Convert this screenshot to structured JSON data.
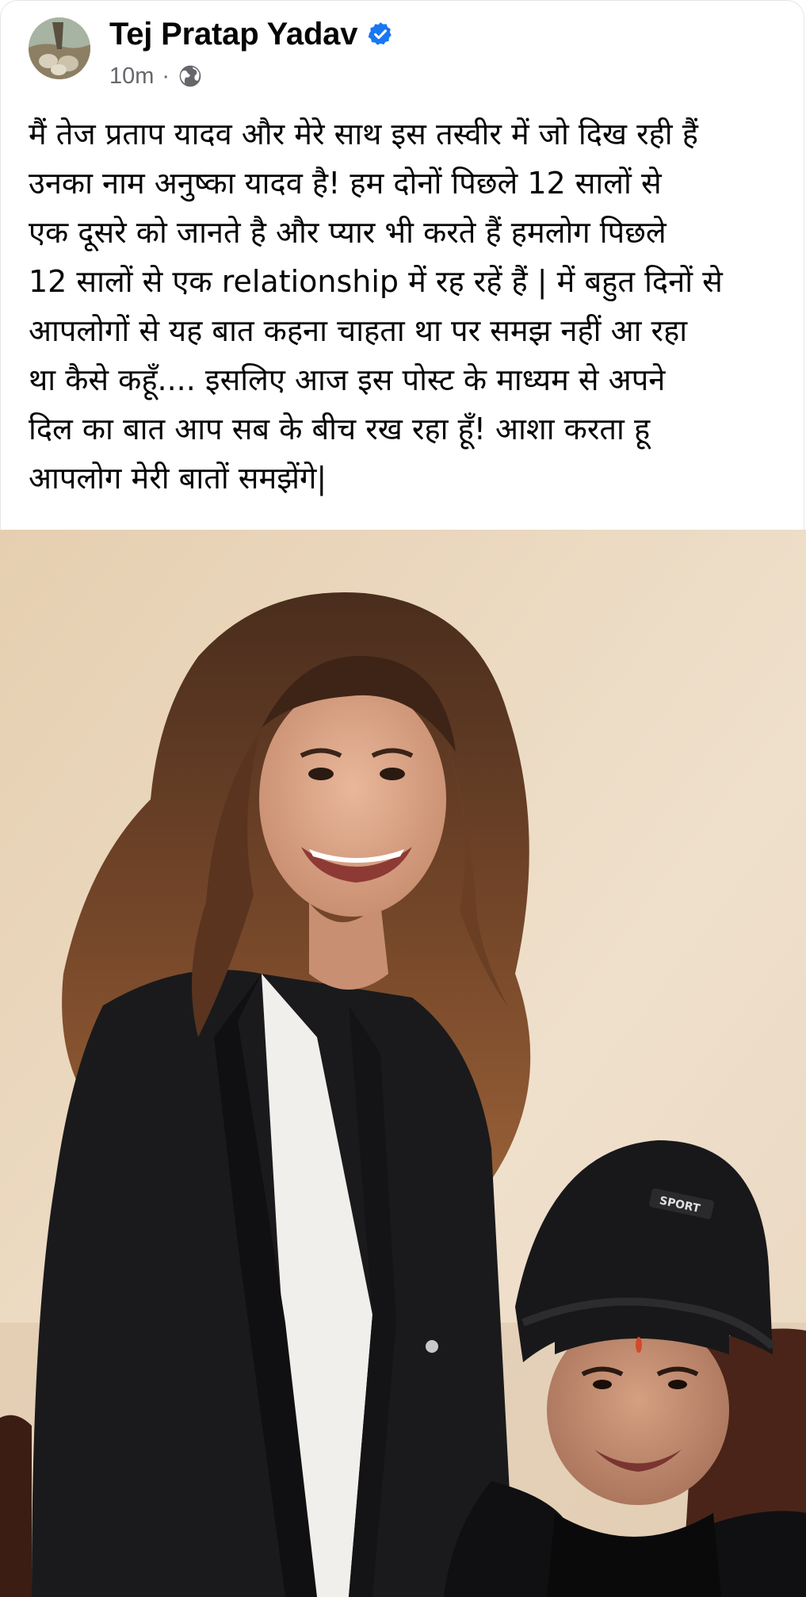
{
  "post": {
    "author": {
      "name": "Tej Pratap Yadav",
      "avatar_alt": "avatar",
      "verified_icon": "verified-badge-icon"
    },
    "timestamp": "10m",
    "separator": "·",
    "audience_icon": "globe-icon",
    "text_lines": [
      "मैं तेज प्रताप यादव और  मेरे साथ इस तस्वीर में जो दिख रही हैं",
      "उनका नाम अनुष्का यादव है! हम दोनों पिछले 12 सालों से",
      "एक दूसरे को जानते है और प्यार भी करते हैं हमलोग पिछले",
      "12 सालों से एक relationship में रह रहें हैं | में बहुत दिनों से",
      "आपलोगों से यह बात कहना चाहता था पर समझ नहीं आ रहा",
      "था कैसे कहूँ.... इसलिए आज इस पोस्ट के माध्यम से अपने",
      "दिल का बात आप सब के बीच रख रहा हूँ! आशा करता हू",
      "आपलोग मेरी बातों समझेंगे|"
    ],
    "photo": {
      "cap_text": "SPORT"
    }
  },
  "colors": {
    "text_primary": "#050505",
    "text_secondary": "#65676b",
    "verified_blue": "#1877f2",
    "wall": "#e8d3b8"
  }
}
